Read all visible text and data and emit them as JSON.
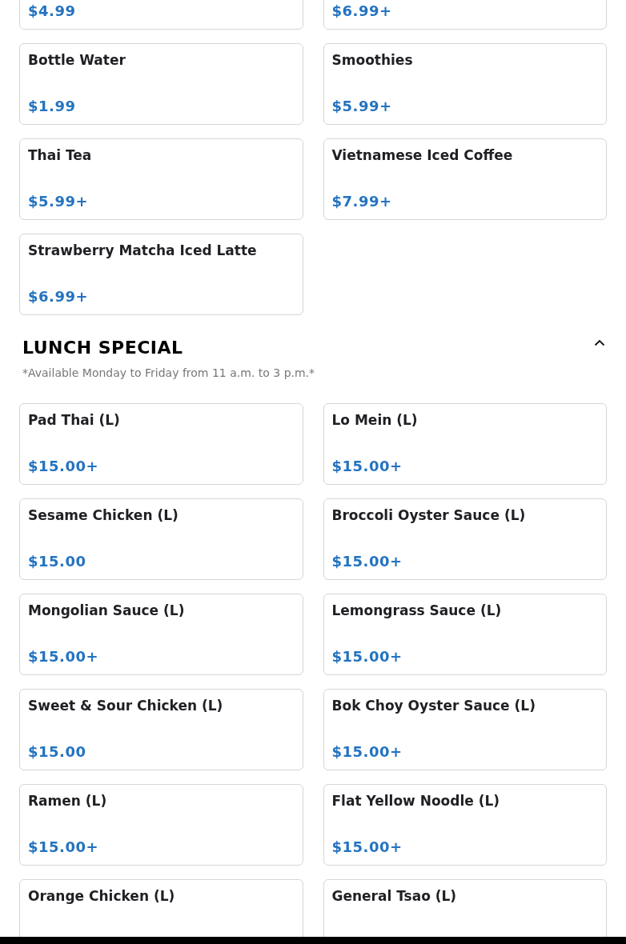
{
  "sections": [
    {
      "items": [
        {
          "price": "$4.99"
        },
        {
          "price": "$6.99+"
        },
        {
          "name": "Bottle Water",
          "price": "$1.99"
        },
        {
          "name": "Smoothies",
          "price": "$5.99+"
        },
        {
          "name": "Thai Tea",
          "price": "$5.99+"
        },
        {
          "name": "Vietnamese Iced Coffee",
          "price": "$7.99+"
        },
        {
          "name": "Strawberry Matcha Iced Latte",
          "price": "$6.99+"
        }
      ]
    },
    {
      "title": "LUNCH SPECIAL",
      "note": "*Available Monday to Friday from 11 a.m. to 3 p.m.*",
      "expanded": true,
      "items": [
        {
          "name": "Pad Thai (L)",
          "price": "$15.00+"
        },
        {
          "name": "Lo Mein (L)",
          "price": "$15.00+"
        },
        {
          "name": "Sesame Chicken (L)",
          "price": "$15.00"
        },
        {
          "name": "Broccoli Oyster Sauce (L)",
          "price": "$15.00+"
        },
        {
          "name": "Mongolian Sauce (L)",
          "price": "$15.00+"
        },
        {
          "name": "Lemongrass Sauce (L)",
          "price": "$15.00+"
        },
        {
          "name": "Sweet & Sour Chicken (L)",
          "price": "$15.00"
        },
        {
          "name": "Bok Choy Oyster Sauce (L)",
          "price": "$15.00+"
        },
        {
          "name": "Ramen (L)",
          "price": "$15.00+"
        },
        {
          "name": "Flat Yellow Noodle (L)",
          "price": "$15.00+"
        },
        {
          "name": "Orange Chicken (L)"
        },
        {
          "name": "General Tsao (L)"
        }
      ]
    }
  ]
}
